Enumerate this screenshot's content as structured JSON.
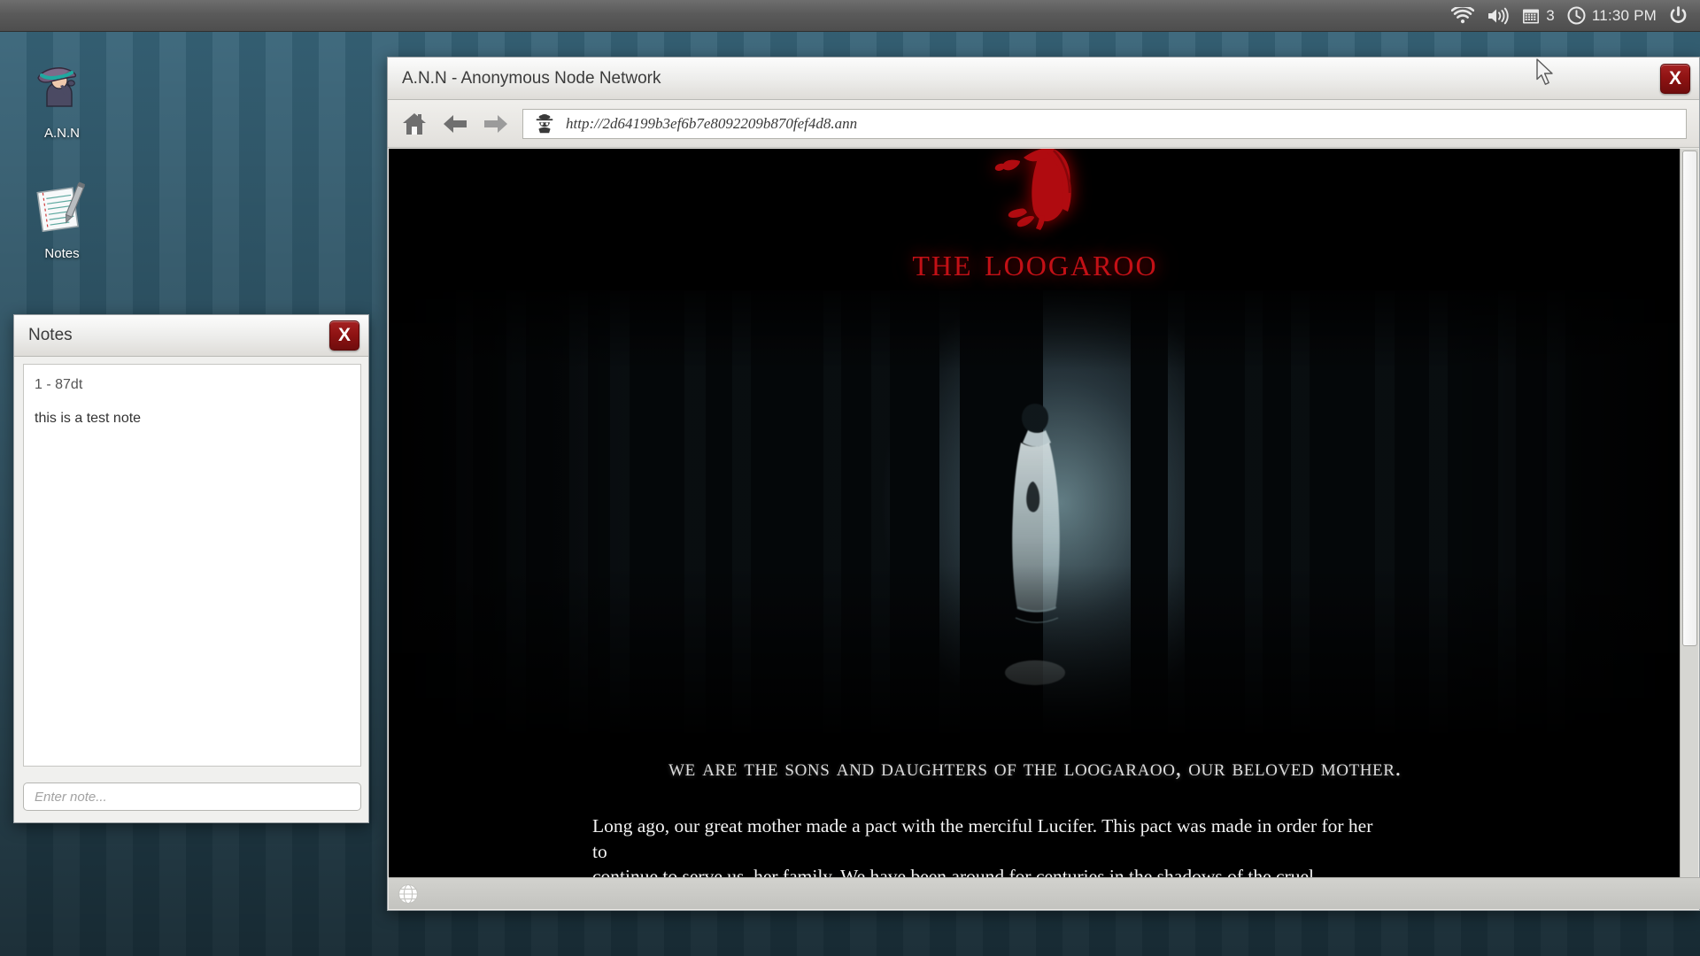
{
  "systray": {
    "wifi_icon": "wifi-icon",
    "volume_icon": "volume-icon",
    "calendar_icon": "calendar-icon",
    "calendar_count": "3",
    "clock_icon": "clock-icon",
    "time": "11:30 PM",
    "power_icon": "power-icon"
  },
  "desktop": {
    "icons": [
      {
        "label": "A.N.N",
        "icon": "detective-icon"
      },
      {
        "label": "Notes",
        "icon": "notepad-icon"
      }
    ]
  },
  "notes_window": {
    "title": "Notes",
    "close_label": "X",
    "close_icon": "close-icon",
    "entries": [
      {
        "id": "1 - 87dt",
        "text": "this is a test note"
      }
    ],
    "input_placeholder": "Enter note..."
  },
  "browser": {
    "title": "A.N.N - Anonymous Node Network",
    "close_label": "X",
    "close_icon": "close-icon",
    "toolbar": {
      "home_icon": "home-icon",
      "back_icon": "back-arrow-icon",
      "forward_icon": "forward-arrow-icon",
      "site_icon": "incognito-detective-icon",
      "url": "http://2d64199b3ef6b7e8092209b870fef4d8.ann"
    },
    "status_bar": {
      "globe_icon": "globe-icon"
    }
  },
  "page": {
    "logo_icon": "vulture-icon",
    "logo_text": "The Loogaroo",
    "headline": "We are the sons and daughters of The Loogaraoo, our beloved mother.",
    "paragraph": "Long ago, our great mother made a pact with the merciful Lucifer. This pact was made in order for her to\ncontinue to serve us, her family.  We have been around for centuries in the shadows of the cruel mankind.\nWe are the ones who stalk the night, the ones who you feel behind you while you walk alone.",
    "image_alt": "ghost-woman-in-dark-forest"
  },
  "colors": {
    "desktop": "#3a6a80",
    "topbar": "#5a5a5a",
    "accent_red": "#c31016",
    "close_red": "#8d1212"
  }
}
